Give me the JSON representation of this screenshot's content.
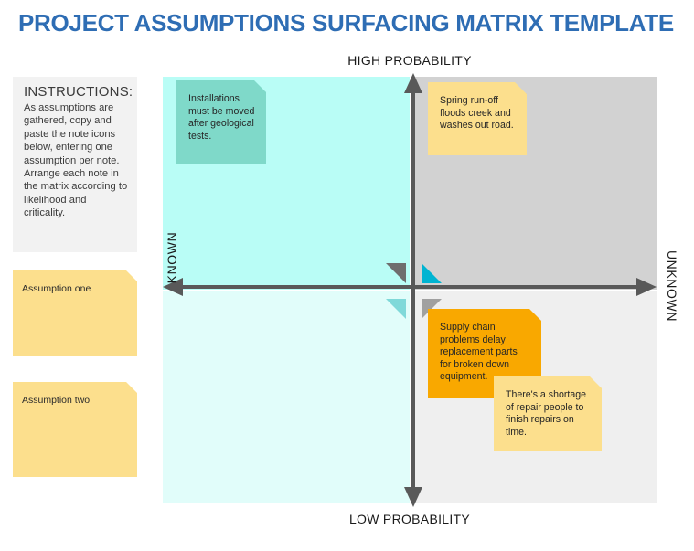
{
  "title": "PROJECT ASSUMPTIONS SURFACING MATRIX TEMPLATE",
  "colors": {
    "title": "#2e6db4",
    "quadrant_top_left": "#b9fdf6",
    "quadrant_top_right": "#d2d2d2",
    "quadrant_bottom_left": "#e1fdfa",
    "quadrant_bottom_right": "#efefef",
    "note_yellow": "#fcdf8d",
    "note_orange": "#f9a800",
    "note_teal": "#7fd9c9",
    "axis": "#595959",
    "accent_cyan": "#00b4d2",
    "accent_grey": "#6e6e6e"
  },
  "instructions": {
    "heading": "INSTRUCTIONS:",
    "body": "As assumptions are gathered, copy and paste the note icons below, entering one assumption per note. Arrange each note in the matrix according to likelihood and criticality."
  },
  "palette_notes": [
    {
      "text": "Assumption one",
      "color": "#fcdf8d"
    },
    {
      "text": "Assumption two",
      "color": "#fcdf8d"
    }
  ],
  "axes": {
    "top_label": "HIGH PROBABILITY",
    "bottom_label": "LOW PROBABILITY",
    "left_label": "KNOWN",
    "right_label": "UNKNOWN"
  },
  "matrix_notes": [
    {
      "id": "installations",
      "text": "Installations must be moved after geological tests.",
      "color": "#7fd9c9",
      "quadrant": "known-high-probability"
    },
    {
      "id": "spring-runoff",
      "text": "Spring run-off floods creek and washes out road.",
      "color": "#fcdf8d",
      "quadrant": "unknown-high-probability"
    },
    {
      "id": "supply-chain",
      "text": "Supply chain problems delay replacement parts for broken down equipment.",
      "color": "#f9a800",
      "quadrant": "unknown-low-probability"
    },
    {
      "id": "repair-people",
      "text": "There's a shortage of repair people to finish repairs on time.",
      "color": "#fcdf8d",
      "quadrant": "unknown-low-probability"
    }
  ]
}
